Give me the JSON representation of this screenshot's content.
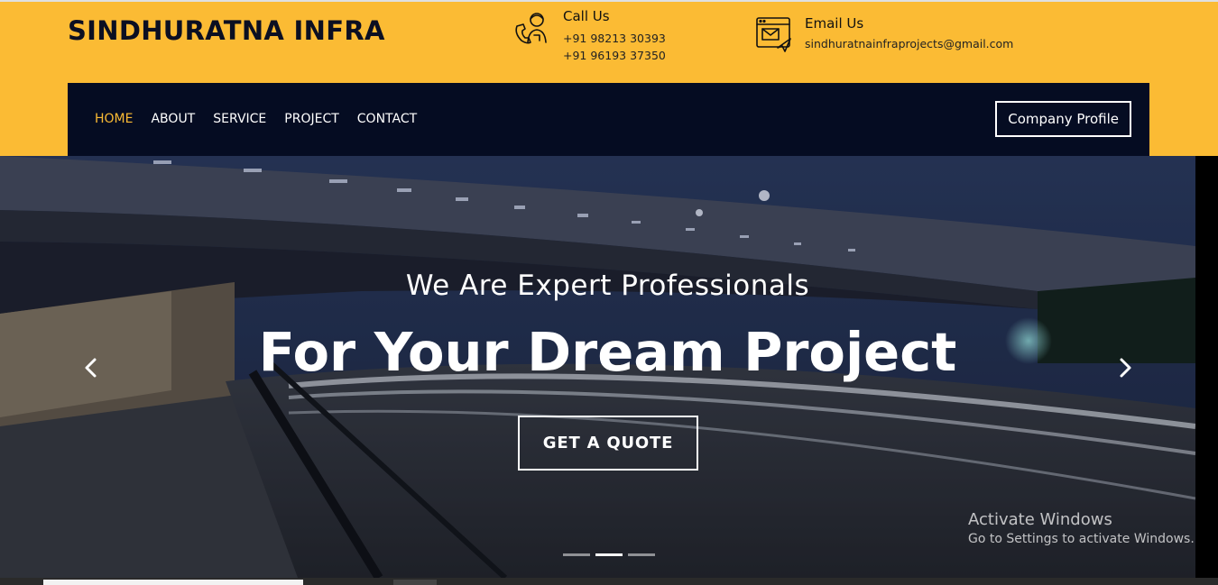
{
  "header": {
    "brand": "SINDHURATNA INFRA",
    "call": {
      "title": "Call Us",
      "lines": [
        "+91 98213 30393",
        "+91 96193 37350"
      ],
      "icon": "support-agent-icon"
    },
    "email": {
      "title": "Email Us",
      "address": "sindhuratnainfraprojects@gmail.com",
      "icon": "email-browser-icon"
    }
  },
  "nav": {
    "items": [
      {
        "label": "HOME",
        "active": true
      },
      {
        "label": "ABOUT"
      },
      {
        "label": "SERVICE"
      },
      {
        "label": "PROJECT"
      },
      {
        "label": "CONTACT"
      }
    ],
    "profile_button": "Company Profile"
  },
  "hero": {
    "subtitle": "We Are Expert Professionals",
    "title": "For Your Dream Project",
    "cta": "GET A QUOTE",
    "active_slide": 2,
    "slide_count": 3
  },
  "watermark": {
    "title": "Activate Windows",
    "subtitle": "Go to Settings to activate Windows."
  },
  "colors": {
    "accent": "#fbbb34",
    "navbar": "#050c22"
  }
}
